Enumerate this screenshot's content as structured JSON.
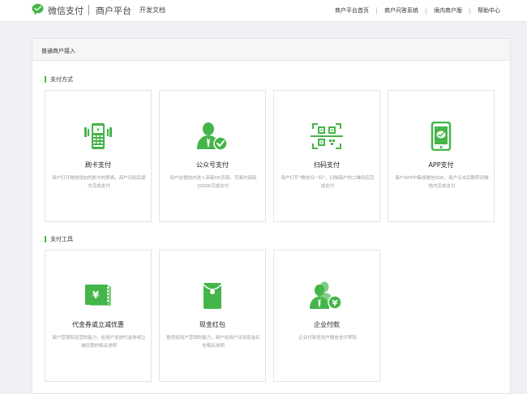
{
  "header": {
    "brand": "微信支付",
    "platform": "商户平台",
    "docs": "开发文档",
    "nav": [
      "商户平台首页",
      "商户问答系统",
      "境内商户版",
      "帮助中心"
    ]
  },
  "panel": {
    "title": "普通商户接入",
    "sections": [
      {
        "title": "支付方式",
        "cards": [
          {
            "title": "刷卡支付",
            "desc": "用户打开微信钱包的刷卡的界面，商户扫码后提交完成支付",
            "icon": "pos-terminal-icon"
          },
          {
            "title": "公众号支付",
            "desc": "用户在微信内进入商家H5页面，页面内调用JSSDK完成支付",
            "icon": "user-check-icon"
          },
          {
            "title": "扫码支付",
            "desc": "用户打开\"微信扫一扫\"，扫描商户的二维码后完成支付",
            "icon": "qr-code-icon"
          },
          {
            "title": "APP支付",
            "desc": "商户APP中集成微信SDK，用户点击后跳转到微信内完成支付",
            "icon": "mobile-app-icon"
          }
        ]
      },
      {
        "title": "支付工具",
        "cards": [
          {
            "title": "代金券或立减优惠",
            "desc": "商户营销和运营的能力，给用户发放代金券或立减优惠的相关说明",
            "icon": "coupon-icon"
          },
          {
            "title": "现金红包",
            "desc": "提供给商户营销的能力，商户给用户派发现金红包相关说明",
            "icon": "red-packet-icon"
          },
          {
            "title": "企业付款",
            "desc": "企业付款至用户微信支付零钱",
            "icon": "enterprise-payment-icon"
          }
        ]
      }
    ]
  },
  "colors": {
    "accent": "#44b549",
    "background": "#eef0f3"
  }
}
